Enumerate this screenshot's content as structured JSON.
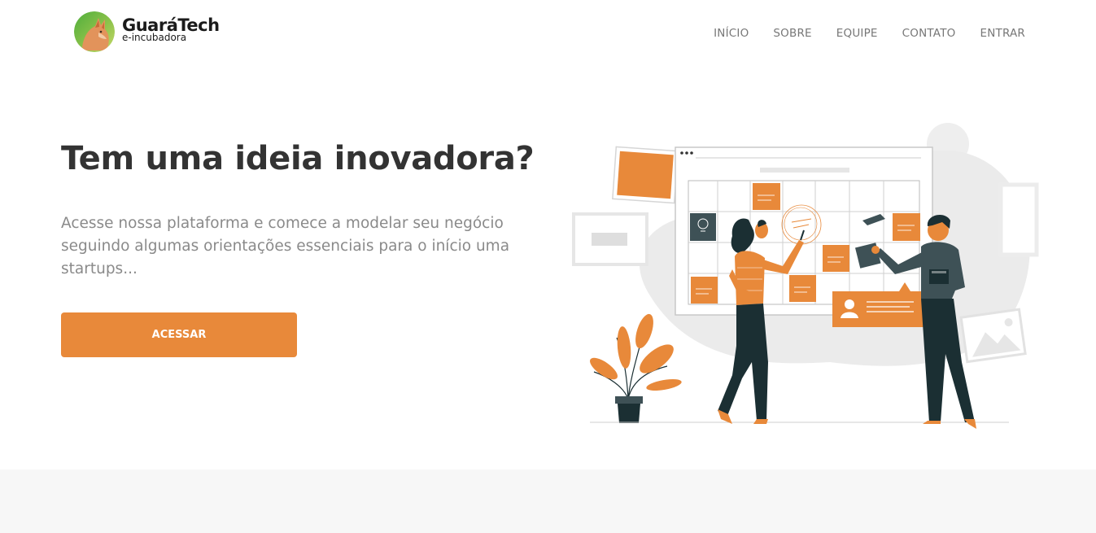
{
  "brand": {
    "name": "GuaráTech",
    "subtitle": "e-incubadora",
    "logo_icon": "guara-wolf-icon",
    "colors": {
      "accent": "#e8893a",
      "dark": "#1b2f33",
      "title": "#333333",
      "muted": "#8a8a8a",
      "nav": "#777777"
    }
  },
  "nav": {
    "items": [
      {
        "label": "INÍCIO"
      },
      {
        "label": "SOBRE"
      },
      {
        "label": "EQUIPE"
      },
      {
        "label": "CONTATO"
      },
      {
        "label": "ENTRAR"
      }
    ]
  },
  "hero": {
    "title": "Tem uma ideia inovadora?",
    "description": "Acesse nossa plataforma e comece a modelar seu negócio seguindo algumas orientações essenciais para o início uma startups...",
    "cta_label": "ACESSAR",
    "illustration_icon": "planning-board-illustration"
  }
}
